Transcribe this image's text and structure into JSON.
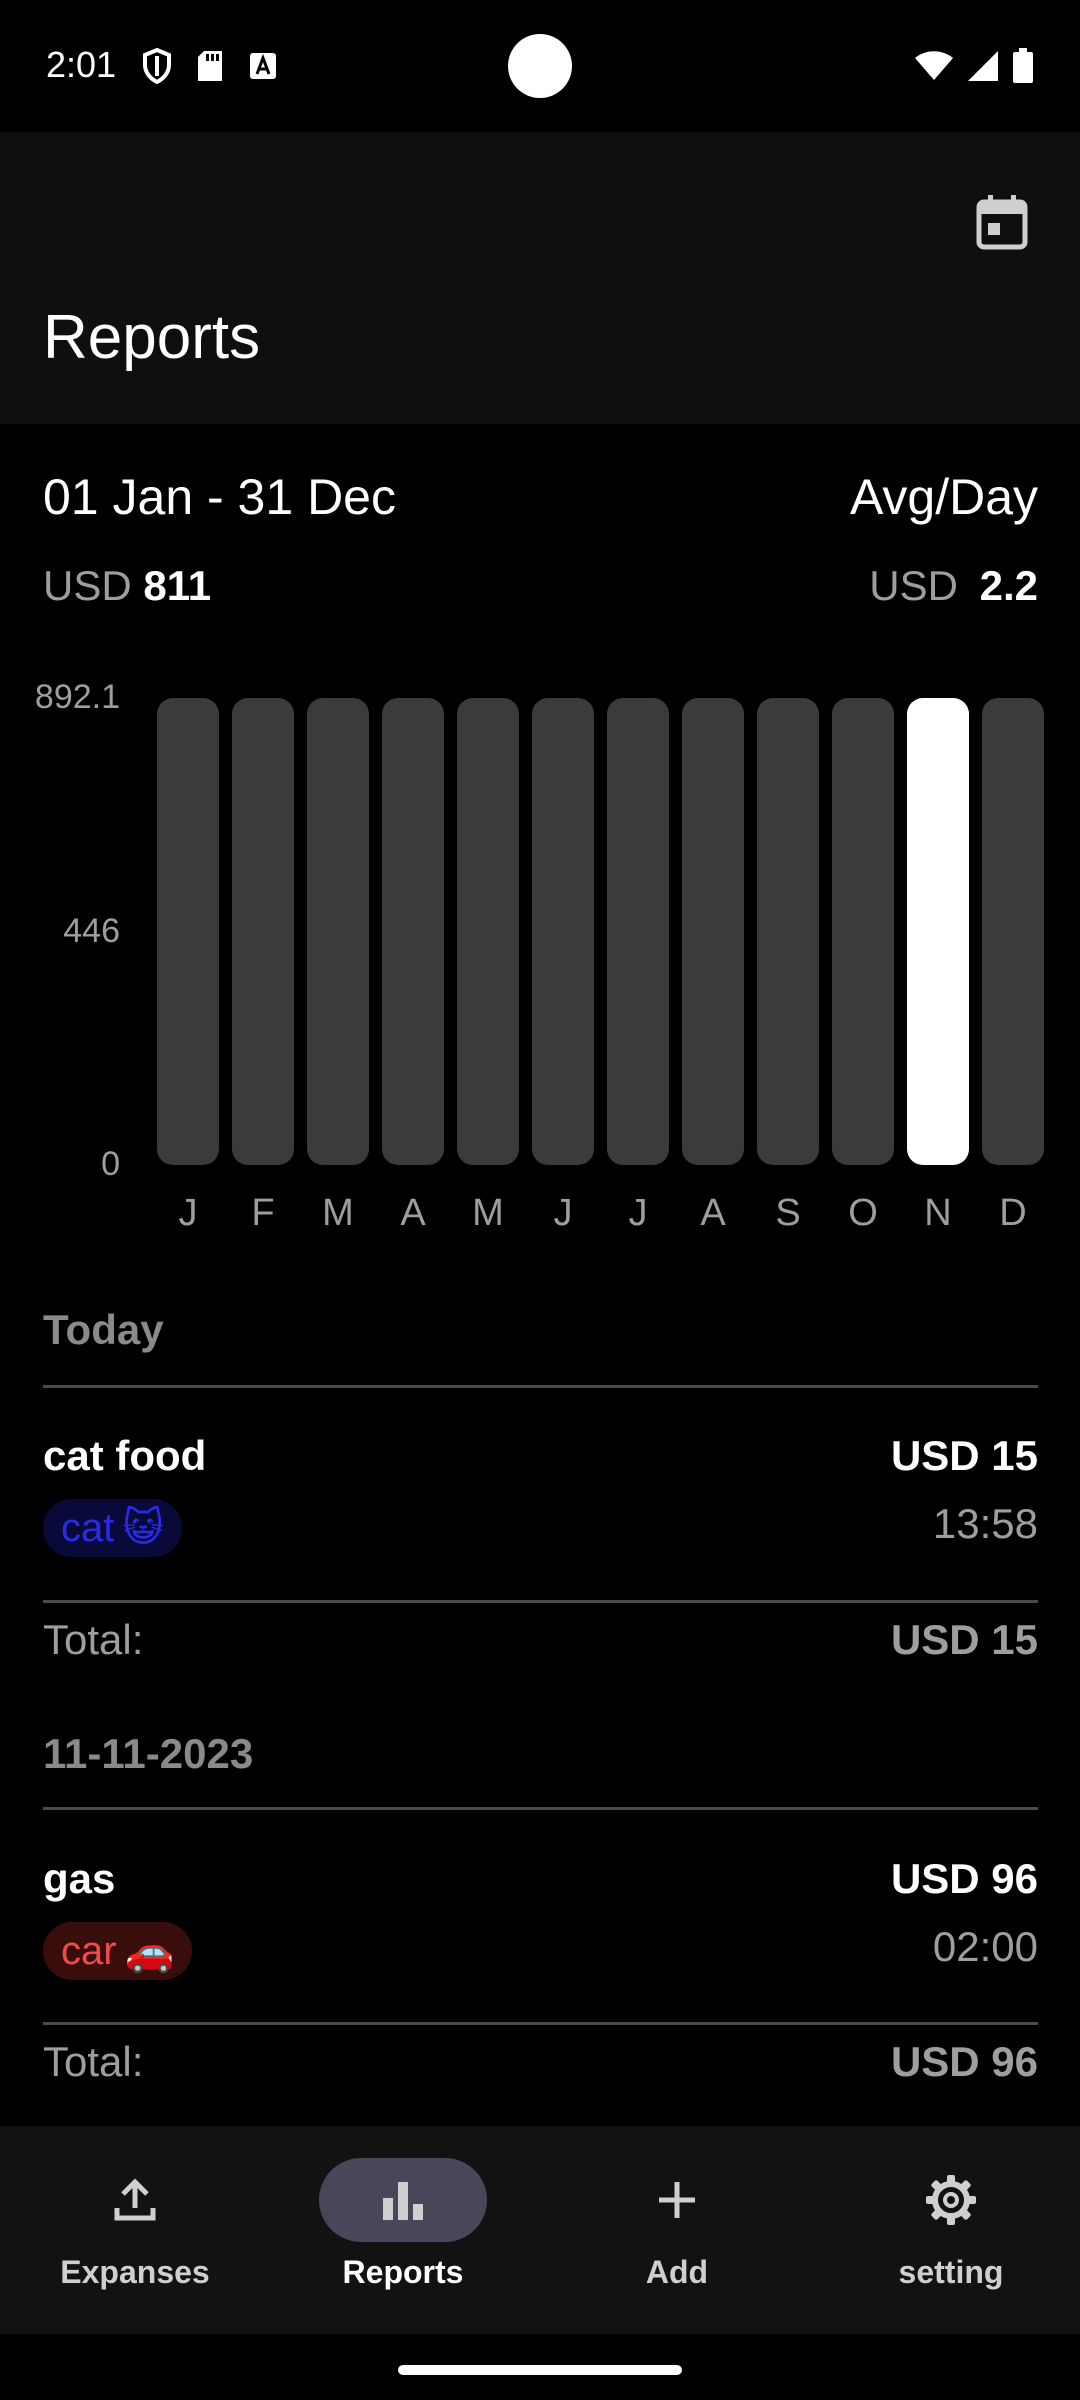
{
  "status_bar": {
    "time": "2:01",
    "left_icons": [
      "shield-icon",
      "sd-card-icon",
      "text-a-icon"
    ],
    "right_icons": [
      "wifi-icon",
      "signal-icon",
      "battery-icon"
    ]
  },
  "app_bar": {
    "title": "Reports",
    "action_icon": "calendar-icon"
  },
  "summary": {
    "range": "01 Jan - 31 Dec",
    "avg_label": "Avg/Day",
    "currency": "USD",
    "total": "811",
    "avg": "2.2"
  },
  "chart_data": {
    "type": "bar",
    "categories": [
      "J",
      "F",
      "M",
      "A",
      "M",
      "J",
      "J",
      "A",
      "S",
      "O",
      "N",
      "D"
    ],
    "values": [
      0,
      0,
      0,
      0,
      0,
      0,
      0,
      0,
      0,
      0,
      892.1,
      0
    ],
    "y_ticks": [
      "892.1",
      "446",
      "0"
    ],
    "ylim": [
      0,
      892.1
    ],
    "highlight_index": 10,
    "colors": {
      "track": "#3b3b3b",
      "highlight": "#ffffff"
    }
  },
  "groups": [
    {
      "header": "Today",
      "items": [
        {
          "title": "cat food",
          "amount": "USD 15",
          "time": "13:58",
          "tag": "cat",
          "tag_emoji": "😺",
          "tag_style": "cat"
        }
      ],
      "total_label": "Total:",
      "total_value": "USD 15"
    },
    {
      "header": "11-11-2023",
      "items": [
        {
          "title": "gas",
          "amount": "USD 96",
          "time": "02:00",
          "tag": "car",
          "tag_emoji": "🚗",
          "tag_style": "car"
        }
      ],
      "total_label": "Total:",
      "total_value": "USD 96"
    }
  ],
  "bottom_nav": {
    "items": [
      {
        "label": "Expanses",
        "icon": "upload-icon",
        "active": false
      },
      {
        "label": "Reports",
        "icon": "bar-chart-icon",
        "active": true
      },
      {
        "label": "Add",
        "icon": "plus-icon",
        "active": false
      },
      {
        "label": "setting",
        "icon": "gear-icon",
        "active": false
      }
    ]
  }
}
